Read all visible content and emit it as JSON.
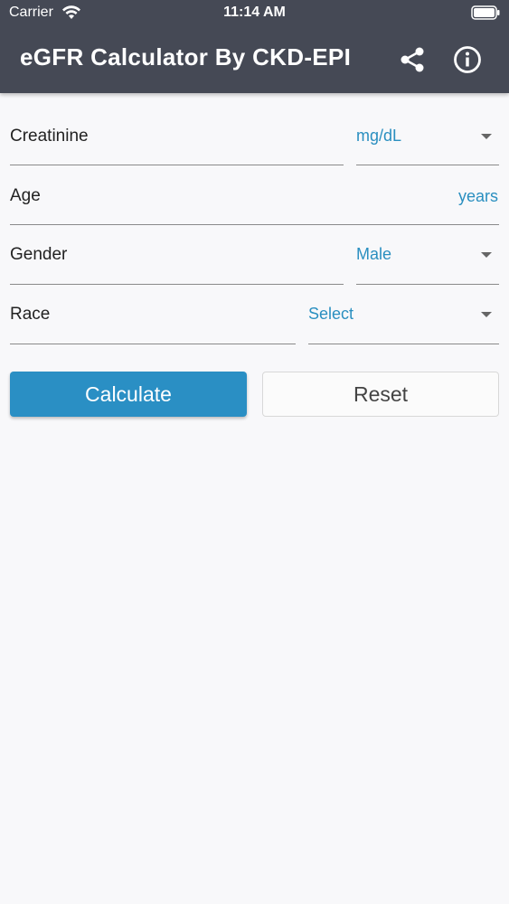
{
  "status_bar": {
    "carrier": "Carrier",
    "time": "11:14 AM",
    "wifi_icon": "wifi-icon",
    "battery_icon": "battery-icon"
  },
  "header": {
    "title": "eGFR Calculator By CKD-EPI",
    "background_color": "#454955",
    "share_icon": "share-icon",
    "info_icon": "info-icon"
  },
  "form": {
    "creatinine": {
      "label": "Creatinine",
      "unit_selected": "mg/dL"
    },
    "age": {
      "label": "Age",
      "unit": "years"
    },
    "gender": {
      "label": "Gender",
      "selected": "Male"
    },
    "race": {
      "label": "Race",
      "selected": "Select"
    }
  },
  "buttons": {
    "calculate": "Calculate",
    "reset": "Reset"
  },
  "accent_color": "#2a8fc4"
}
